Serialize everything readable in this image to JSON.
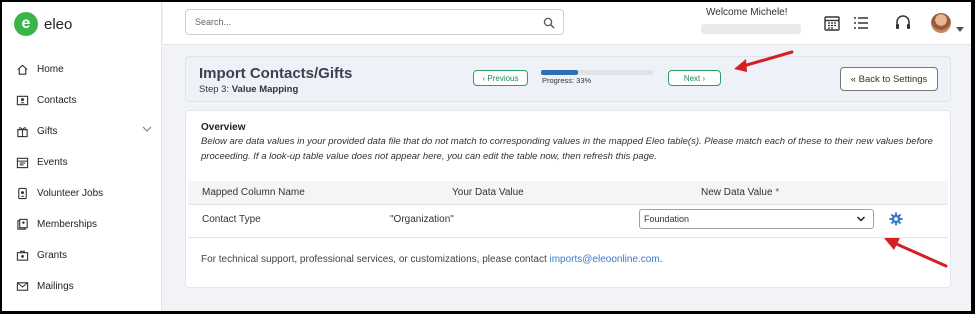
{
  "app": {
    "name": "eleo",
    "logo_letter": "e"
  },
  "sidebar": {
    "items": [
      {
        "label": "Home",
        "icon": "home-icon"
      },
      {
        "label": "Contacts",
        "icon": "contacts-icon"
      },
      {
        "label": "Gifts",
        "icon": "gift-icon",
        "expandable": true
      },
      {
        "label": "Events",
        "icon": "calendar-icon"
      },
      {
        "label": "Volunteer Jobs",
        "icon": "volunteer-icon"
      },
      {
        "label": "Memberships",
        "icon": "membership-icon"
      },
      {
        "label": "Grants",
        "icon": "grant-icon"
      },
      {
        "label": "Mailings",
        "icon": "mail-icon"
      }
    ]
  },
  "topbar": {
    "search_placeholder": "Search...",
    "welcome": "Welcome Michele!"
  },
  "header": {
    "title": "Import Contacts/Gifts",
    "step_prefix": "Step 3:",
    "step_name": "Value Mapping",
    "previous_label": "Previous",
    "next_label": "Next",
    "progress_label": "Progress: 33%",
    "progress_fraction": 0.33,
    "back_label": "Back to Settings"
  },
  "overview": {
    "title": "Overview",
    "text": "Below are data values in your provided data file that do not match to corresponding values in the mapped Eleo table(s). Please match each of these to their new values before proceeding. If a look-up table value does not appear here, you can edit the table now, then refresh this page."
  },
  "table": {
    "headers": [
      "Mapped Column Name",
      "Your Data Value",
      "New Data Value"
    ],
    "required_marker": "*",
    "rows": [
      {
        "column": "Contact Type",
        "data_value": "\"Organization\"",
        "new_value": "Foundation"
      }
    ]
  },
  "support": {
    "text": "For technical support, professional services, or customizations, please contact ",
    "email": "imports@eleoonline.com",
    "suffix": "."
  },
  "colors": {
    "accent_green": "#2e9e69",
    "progress_blue": "#2e6fb5",
    "annotation_red": "#d42020",
    "brand_green": "#3bb54a"
  }
}
